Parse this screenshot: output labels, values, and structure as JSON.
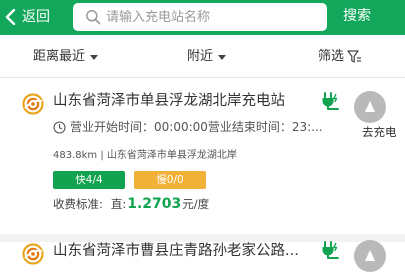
{
  "header": {
    "back_label": "返回",
    "search_placeholder": "请输入充电站名称",
    "search_button": "搜索",
    "background_color": "#12a75a"
  },
  "filters": {
    "distance": "距离最近",
    "nearby": "附近",
    "filter": "筛选"
  },
  "stations": [
    {
      "name": "山东省菏泽市单县浮龙湖北岸充电站",
      "hours": "营业开始时间：00:00:00营业结束时间：23:...",
      "distance_address": "483.8km | 山东省菏泽市单县浮龙湖北岸",
      "fast": "快4/4",
      "slow": "慢0/0",
      "fee_label": "收费标准:",
      "fee_type": "直:",
      "fee_price": "1.2703",
      "fee_unit": "元/度",
      "nav_label": "去充电"
    },
    {
      "name": "山东省菏泽市曹县庄青路孙老家公路..."
    }
  ],
  "colors": {
    "accent_green": "#11a34f",
    "slow_badge": "#f1b036",
    "nav_gray": "#b9b9b9"
  }
}
